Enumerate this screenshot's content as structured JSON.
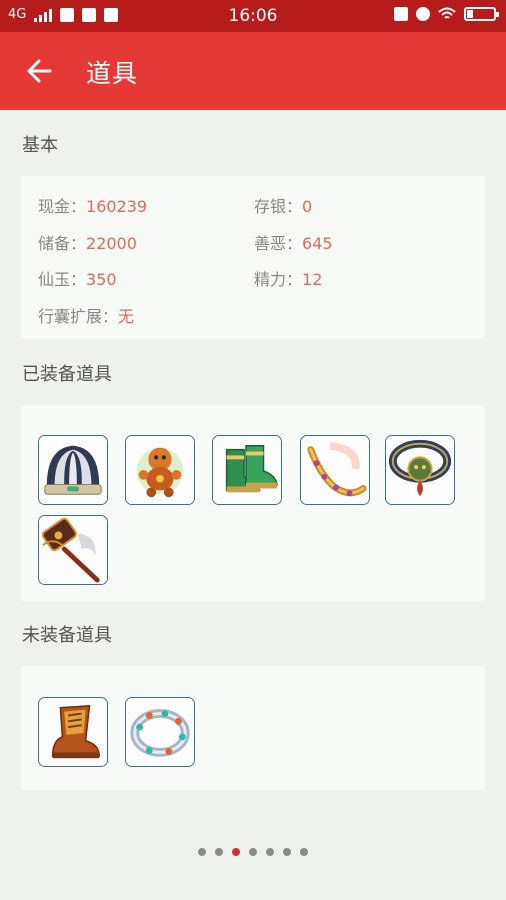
{
  "status_bar": {
    "network": "4G",
    "time": "16:06",
    "colors": {
      "background": "#b71c1c"
    }
  },
  "app_bar": {
    "title": "道具",
    "back_icon": "arrow-left-icon",
    "colors": {
      "background": "#e53935"
    }
  },
  "basic": {
    "section_title": "基本",
    "items": [
      {
        "label": "现金：",
        "value": "160239"
      },
      {
        "label": "存银：",
        "value": "0"
      },
      {
        "label": "储备：",
        "value": "22000"
      },
      {
        "label": "善恶：",
        "value": "645"
      },
      {
        "label": "仙玉：",
        "value": "350"
      },
      {
        "label": "精力：",
        "value": "12"
      },
      {
        "label": "行囊扩展：",
        "value": "无"
      }
    ]
  },
  "equipped": {
    "section_title": "已装备道具",
    "items": [
      {
        "icon": "helmet-icon"
      },
      {
        "icon": "pet-doll-icon"
      },
      {
        "icon": "boots-icon"
      },
      {
        "icon": "belt-icon"
      },
      {
        "icon": "necklace-icon"
      },
      {
        "icon": "hammer-icon"
      }
    ]
  },
  "unequipped": {
    "section_title": "未装备道具",
    "items": [
      {
        "icon": "armor-boots-icon"
      },
      {
        "icon": "bracelet-icon"
      }
    ]
  },
  "pager": {
    "pages": 7,
    "current_page": 3,
    "colors": {
      "active": "#d32f2f",
      "inactive": "#8a8a8a"
    }
  },
  "colors": {
    "accent": "#e53935",
    "value_text": "#e06858",
    "page_background": "#eef1ec"
  }
}
